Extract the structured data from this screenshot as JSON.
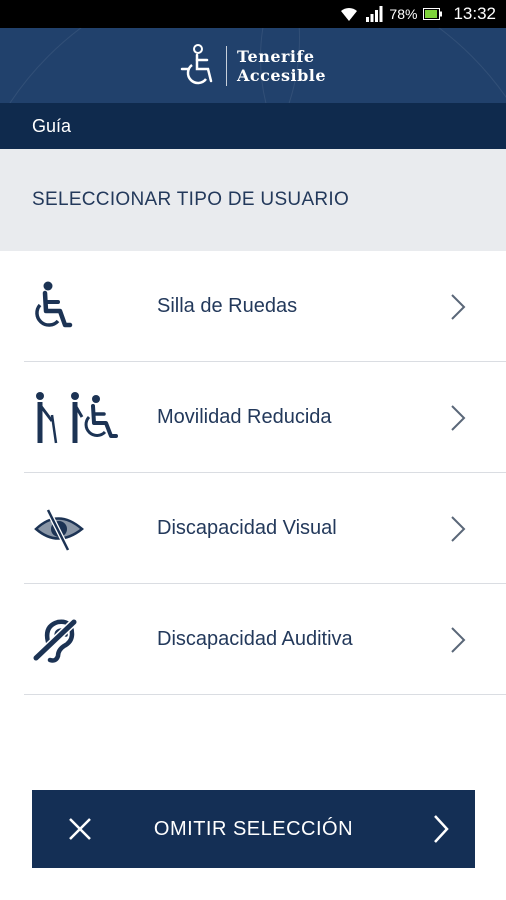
{
  "status_bar": {
    "battery": "78%",
    "time": "13:32",
    "icons": [
      "wifi-icon",
      "signal-icon",
      "battery-icon"
    ]
  },
  "header": {
    "brand_line1": "Tenerife",
    "brand_line2": "Accesible",
    "logo_icon": "wheelchair-logo-icon"
  },
  "nav": {
    "title": "Guía"
  },
  "section": {
    "title": "SELECCIONAR TIPO DE USUARIO"
  },
  "user_types": [
    {
      "label": "Silla de Ruedas",
      "icon": "wheelchair-icon"
    },
    {
      "label": "Movilidad Reducida",
      "icon": "reduced-mobility-icon"
    },
    {
      "label": "Discapacidad Visual",
      "icon": "visual-impairment-icon"
    },
    {
      "label": "Discapacidad Auditiva",
      "icon": "hearing-impairment-icon"
    }
  ],
  "omit_button": {
    "label": "OMITIR SELECCIÓN",
    "left_icon": "close-icon",
    "right_icon": "chevron-right-icon"
  },
  "colors": {
    "header": "#21416c",
    "nav_bar": "#0f2a4d",
    "section_bg": "#e9ebee",
    "button": "#142f55",
    "text": "#23395b"
  }
}
